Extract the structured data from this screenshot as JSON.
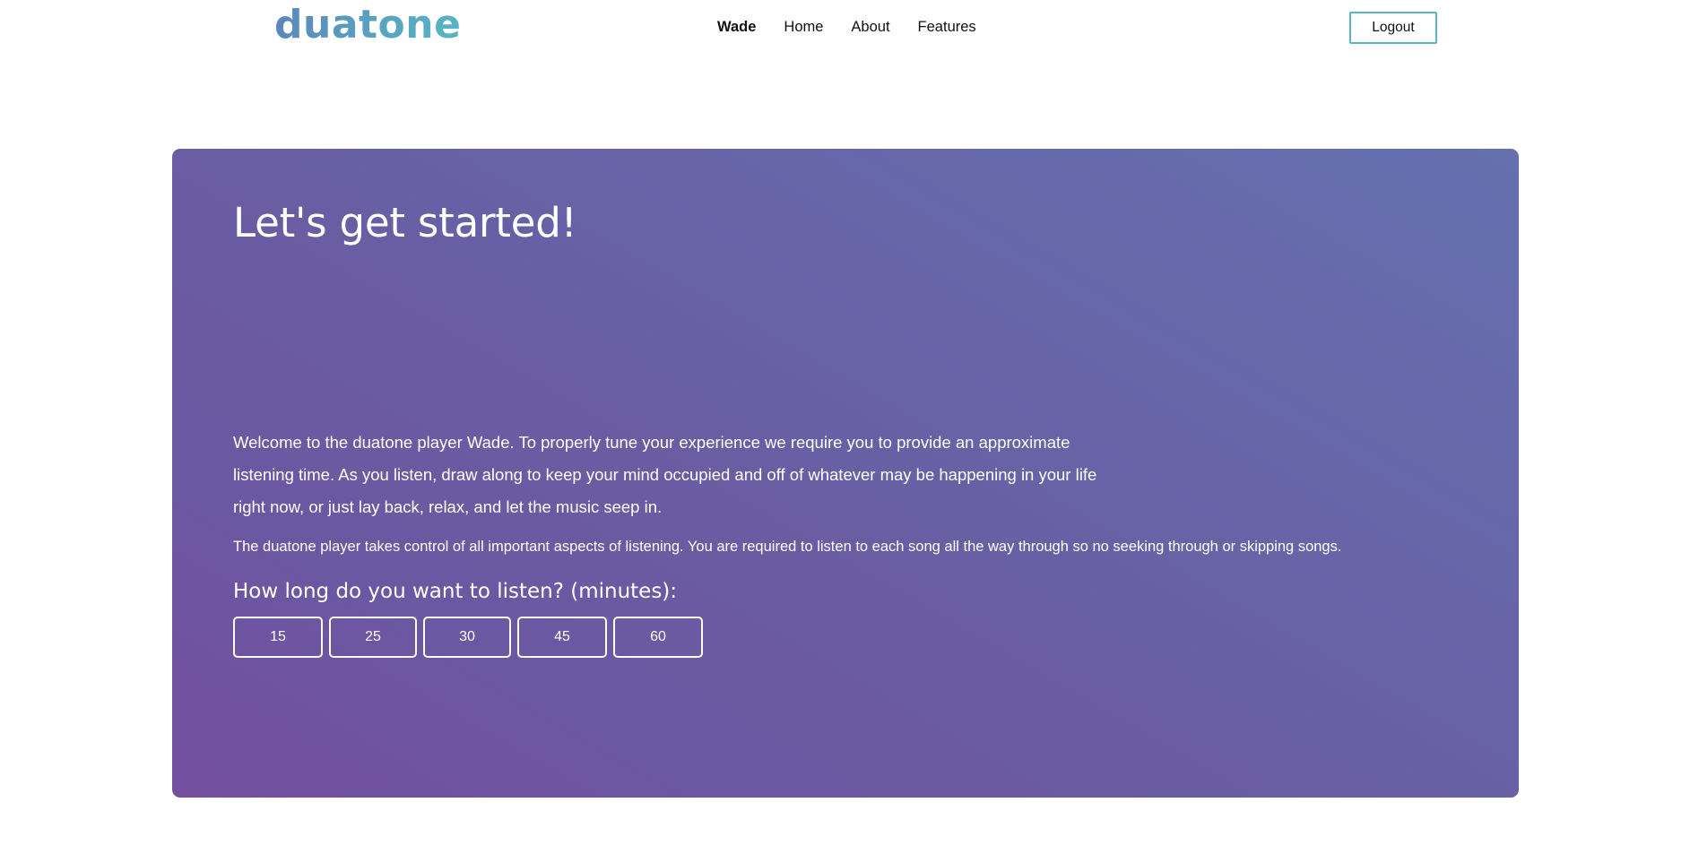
{
  "header": {
    "brand": "duatone",
    "nav": [
      {
        "label": "Wade",
        "active": true
      },
      {
        "label": "Home",
        "active": false
      },
      {
        "label": "About",
        "active": false
      },
      {
        "label": "Features",
        "active": false
      }
    ],
    "logout_label": "Logout"
  },
  "hero": {
    "title": "Let's get started!",
    "intro_paragraph": "Welcome to the duatone player Wade. To properly tune your experience we require you to provide an approximate listening time. As you listen, draw along to keep your mind occupied and off of whatever may be happening in your life right now, or just lay back, relax, and let the music seep in.",
    "rules_paragraph": "The duatone player takes control of all important aspects of listening. You are required to listen to each song all the way through so no seeking through or skipping songs.",
    "duration_prompt": "How long do you want to listen? (minutes):",
    "duration_options": [
      "15",
      "25",
      "30",
      "45",
      "60"
    ],
    "submit": {
      "icon": "loading-spinner-icon",
      "label": ""
    }
  },
  "colors": {
    "brand_gradient_start": "#5b88ba",
    "brand_gradient_end": "#57b5c4",
    "accent_teal": "#57b6c2",
    "submit_teal": "#4fbcc6",
    "card_purple": "#744f9f",
    "card_blue": "#6570af",
    "text_on_card": "#ffffff",
    "page_background": "#ffffff"
  }
}
